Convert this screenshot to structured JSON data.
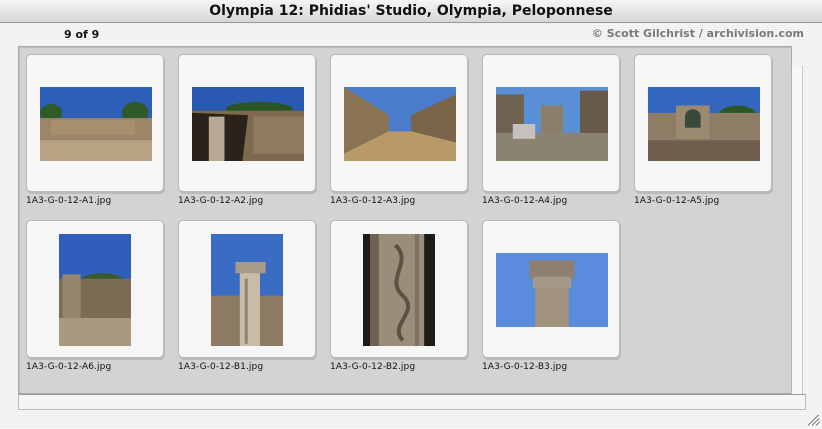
{
  "window": {
    "title": "Olympia 12: Phidias' Studio, Olympia, Peloponnese"
  },
  "header": {
    "count": "9 of 9",
    "copyright": "© Scott Gilchrist / archivision.com"
  },
  "thumbnails": [
    {
      "filename": "1A3-G-0-12-A1.jpg",
      "orientation": "landscape",
      "scene": "wide-ruins",
      "sky": "#2d5fb8",
      "ground": "#9c8568"
    },
    {
      "filename": "1A3-G-0-12-A2.jpg",
      "orientation": "landscape",
      "scene": "wall-shadow",
      "sky": "#2a59b2",
      "ground": "#7d6a4f"
    },
    {
      "filename": "1A3-G-0-12-A3.jpg",
      "orientation": "landscape",
      "scene": "corridor",
      "sky": "#4a7ccc",
      "ground": "#b89a68"
    },
    {
      "filename": "1A3-G-0-12-A4.jpg",
      "orientation": "landscape",
      "scene": "courtyard",
      "sky": "#5a8fd6",
      "ground": "#8c8270"
    },
    {
      "filename": "1A3-G-0-12-A5.jpg",
      "orientation": "landscape",
      "scene": "arch",
      "sky": "#3266bf",
      "ground": "#8e7d66"
    },
    {
      "filename": "1A3-G-0-12-A6.jpg",
      "orientation": "portrait",
      "scene": "tall-wall",
      "sky": "#2f5fba",
      "ground": "#7c6c55"
    },
    {
      "filename": "1A3-G-0-12-B1.jpg",
      "orientation": "portrait",
      "scene": "column-sky",
      "sky": "#3a6cc4",
      "ground": "#8c7a63"
    },
    {
      "filename": "1A3-G-0-12-B2.jpg",
      "orientation": "portrait",
      "scene": "carved-column",
      "sky": "#1e1a16",
      "ground": "#9a8d7a"
    },
    {
      "filename": "1A3-G-0-12-B3.jpg",
      "orientation": "landscape",
      "scene": "capital",
      "sky": "#5b8bdc",
      "ground": "#a39480"
    }
  ]
}
